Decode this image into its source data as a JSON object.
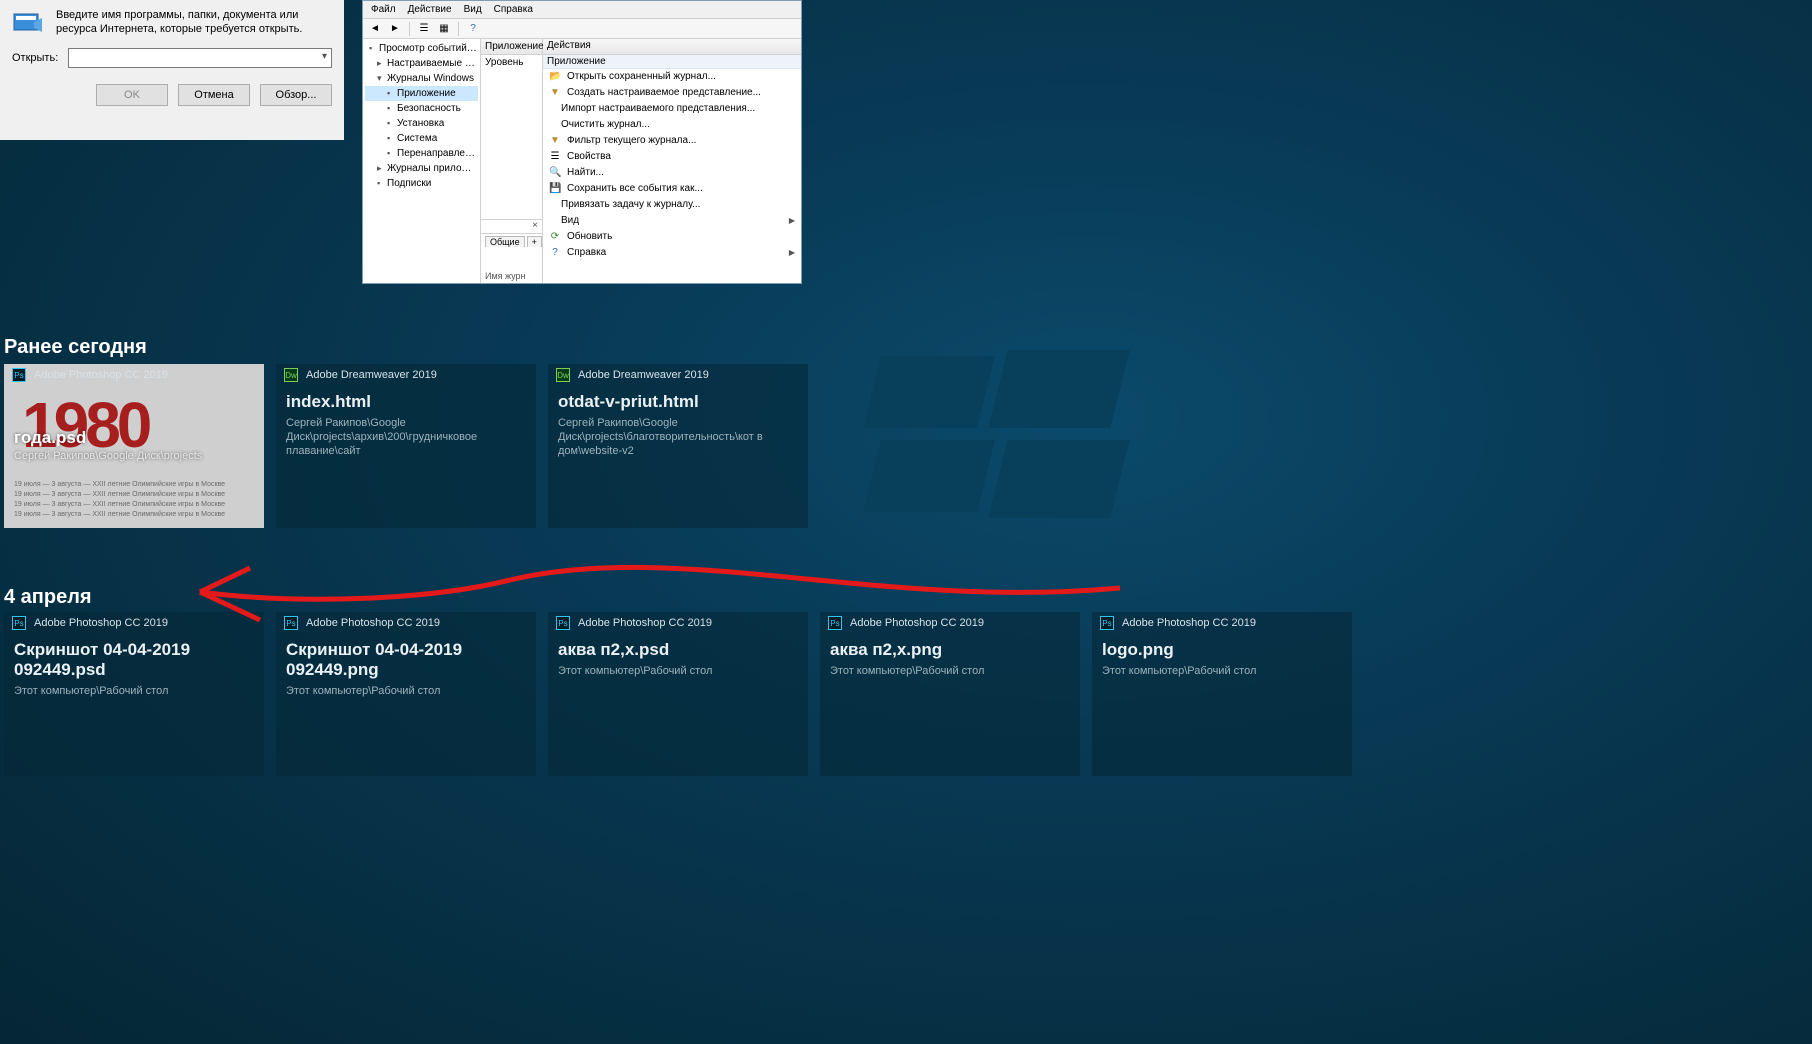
{
  "run_dialog": {
    "prompt": "Введите имя программы, папки, документа или ресурса Интернета, которые требуется открыть.",
    "open_label": "Открыть:",
    "btn_ok": "OK",
    "btn_cancel": "Отмена",
    "btn_browse": "Обзор..."
  },
  "event_viewer": {
    "menu": {
      "file": "Файл",
      "action": "Действие",
      "view": "Вид",
      "help": "Справка"
    },
    "tree": {
      "root": "Просмотр событий (Локальный)",
      "custom_views": "Настраиваемые представления",
      "windows_logs": "Журналы Windows",
      "app": "Приложение",
      "security": "Безопасность",
      "setup": "Установка",
      "system": "Система",
      "forwarded": "Перенаправленные события",
      "apps_services": "Журналы приложений и служб",
      "subscriptions": "Подписки"
    },
    "center": {
      "header": "Приложение",
      "level": "Уровень",
      "tabs_general": "Общие",
      "log_name": "Имя журн"
    },
    "actions": {
      "header": "Действия",
      "section": "Приложение",
      "open_saved": "Открыть сохраненный журнал...",
      "create_view": "Создать настраиваемое представление...",
      "import_view": "Импорт настраиваемого представления...",
      "clear_log": "Очистить журнал...",
      "filter": "Фильтр текущего журнала...",
      "properties": "Свойства",
      "find": "Найти...",
      "save_all": "Сохранить все события как...",
      "attach_task": "Привязать задачу к журналу...",
      "view": "Вид",
      "refresh": "Обновить",
      "help": "Справка"
    }
  },
  "sections": {
    "earlier_today": "Ранее сегодня",
    "april4": "4 апреля"
  },
  "apps": {
    "ps": "Adobe Photoshop CC 2019",
    "dw": "Adobe Dreamweaver 2019"
  },
  "cards_today": [
    {
      "app": "ps",
      "title": "года.psd",
      "path": "Сергей Ракипов\\Google Диск\\projects",
      "thumb_year": "1980",
      "thumb_line": "19 июля — 3 августа — XXII летние Олимпийские игры в Москве"
    },
    {
      "app": "dw",
      "title": "index.html",
      "path": "Сергей Ракипов\\Google Диск\\projects\\архив\\200\\грудничковое плавание\\сайт"
    },
    {
      "app": "dw",
      "title": "otdat-v-priut.html",
      "path": "Сергей Ракипов\\Google Диск\\projects\\благотворительность\\кот в дом\\website-v2"
    }
  ],
  "cards_april4": [
    {
      "app": "ps",
      "title": "Скриншот 04-04-2019 092449.psd",
      "path": "Этот компьютер\\Рабочий стол"
    },
    {
      "app": "ps",
      "title": "Скриншот 04-04-2019 092449.png",
      "path": "Этот компьютер\\Рабочий стол"
    },
    {
      "app": "ps",
      "title": "аква п2,x.psd",
      "path": "Этот компьютер\\Рабочий стол"
    },
    {
      "app": "ps",
      "title": "аква п2,x.png",
      "path": "Этот компьютер\\Рабочий стол"
    },
    {
      "app": "ps",
      "title": "logo.png",
      "path": "Этот компьютер\\Рабочий стол"
    }
  ]
}
